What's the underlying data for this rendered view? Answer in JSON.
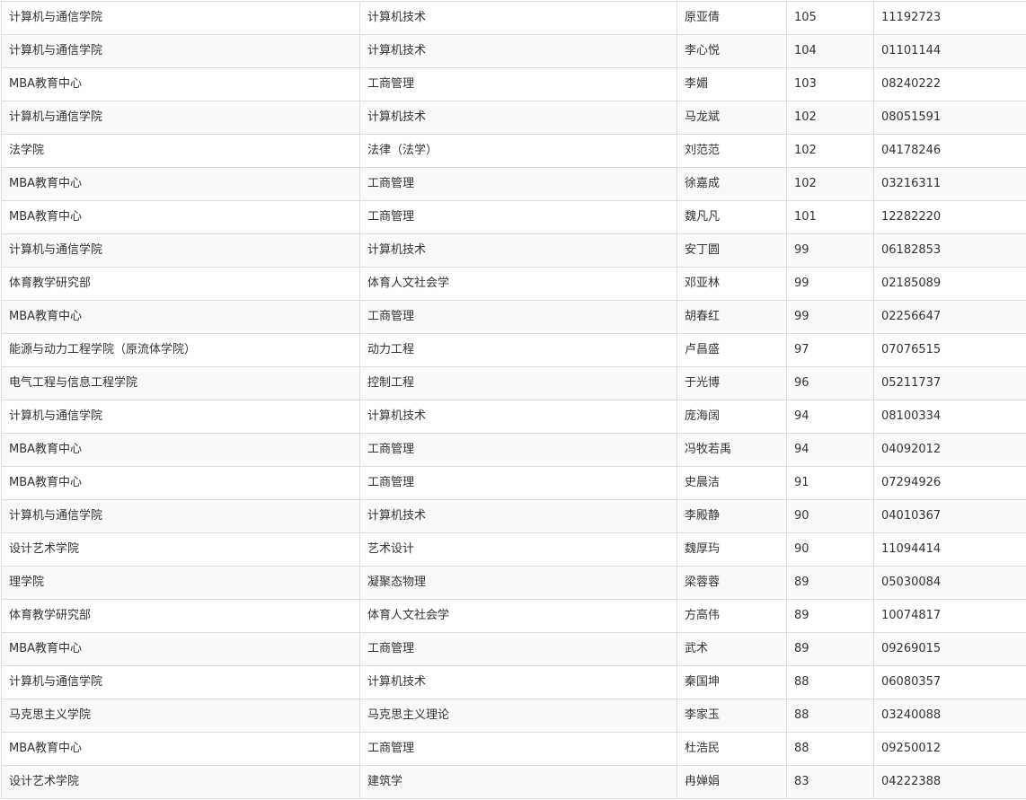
{
  "rows": [
    [
      "计算机与通信学院",
      "计算机技术",
      "原亚倩",
      "105",
      "11192723"
    ],
    [
      "计算机与通信学院",
      "计算机技术",
      "李心悦",
      "104",
      "01101144"
    ],
    [
      "MBA教育中心",
      "工商管理",
      "李媚",
      "103",
      "08240222"
    ],
    [
      "计算机与通信学院",
      "计算机技术",
      "马龙斌",
      "102",
      "08051591"
    ],
    [
      "法学院",
      "法律（法学）",
      "刘范范",
      "102",
      "04178246"
    ],
    [
      "MBA教育中心",
      "工商管理",
      "徐嘉成",
      "102",
      "03216311"
    ],
    [
      "MBA教育中心",
      "工商管理",
      "魏凡凡",
      "101",
      "12282220"
    ],
    [
      "计算机与通信学院",
      "计算机技术",
      "安丁圆",
      "99",
      "06182853"
    ],
    [
      "体育教学研究部",
      "体育人文社会学",
      "邓亚林",
      "99",
      "02185089"
    ],
    [
      "MBA教育中心",
      "工商管理",
      "胡春红",
      "99",
      "02256647"
    ],
    [
      "能源与动力工程学院（原流体学院）",
      "动力工程",
      "卢昌盛",
      "97",
      "07076515"
    ],
    [
      "电气工程与信息工程学院",
      "控制工程",
      "于光博",
      "96",
      "05211737"
    ],
    [
      "计算机与通信学院",
      "计算机技术",
      "庞海阔",
      "94",
      "08100334"
    ],
    [
      "MBA教育中心",
      "工商管理",
      "冯牧若禹",
      "94",
      "04092012"
    ],
    [
      "MBA教育中心",
      "工商管理",
      "史晨洁",
      "91",
      "07294926"
    ],
    [
      "计算机与通信学院",
      "计算机技术",
      "李殿静",
      "90",
      "04010367"
    ],
    [
      "设计艺术学院",
      "艺术设计",
      "魏厚玙",
      "90",
      "11094414"
    ],
    [
      "理学院",
      "凝聚态物理",
      "梁蓉蓉",
      "89",
      "05030084"
    ],
    [
      "体育教学研究部",
      "体育人文社会学",
      "方高伟",
      "89",
      "10074817"
    ],
    [
      "MBA教育中心",
      "工商管理",
      "武术",
      "89",
      "09269015"
    ],
    [
      "计算机与通信学院",
      "计算机技术",
      "秦国坤",
      "88",
      "06080357"
    ],
    [
      "马克思主义学院",
      "马克思主义理论",
      "李家玉",
      "88",
      "03240088"
    ],
    [
      "MBA教育中心",
      "工商管理",
      "杜浩民",
      "88",
      "09250012"
    ],
    [
      "设计艺术学院",
      "建筑学",
      "冉婵娟",
      "83",
      "04222388"
    ]
  ]
}
